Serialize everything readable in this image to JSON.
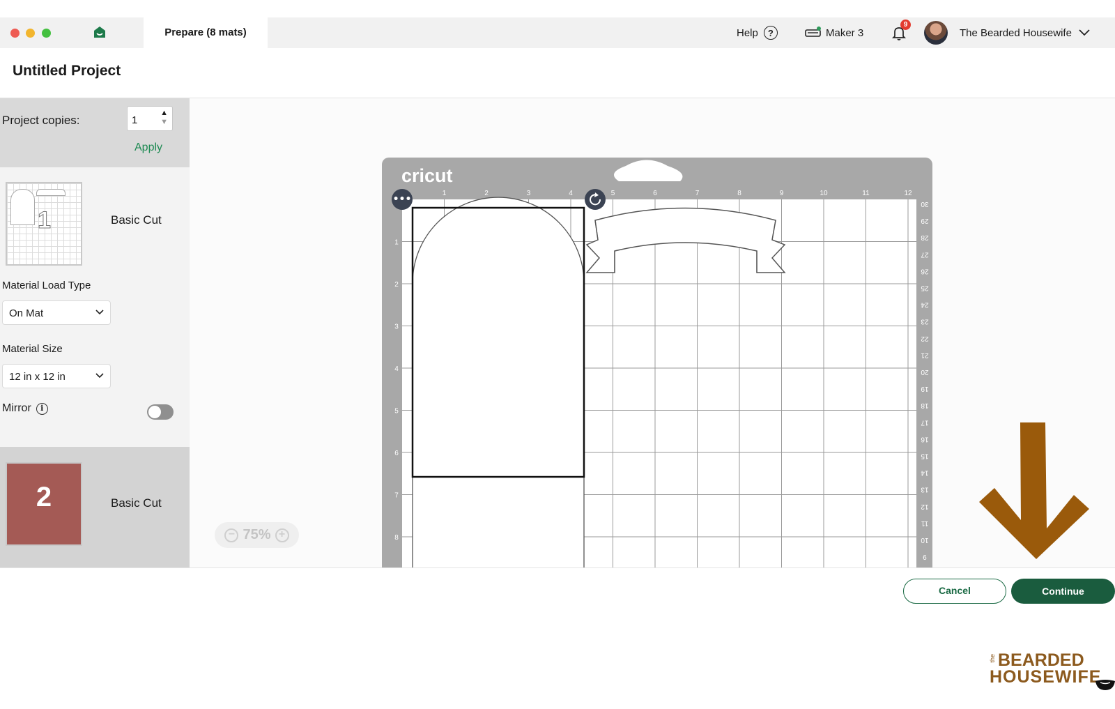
{
  "titlebar": {
    "tab_label": "Prepare (8 mats)",
    "help_label": "Help",
    "help_glyph": "?",
    "machine_label": "Maker 3",
    "notification_count": "9",
    "user_name": "The Bearded Housewife"
  },
  "project": {
    "title": "Untitled Project"
  },
  "sidebar": {
    "copies_label": "Project copies:",
    "copies_value": "1",
    "apply_label": "Apply",
    "mats": [
      {
        "number": "1",
        "cut_type": "Basic Cut",
        "color": "#ffffff"
      },
      {
        "number": "2",
        "cut_type": "Basic Cut",
        "color": "#a45a55"
      }
    ],
    "material_load_type_label": "Material Load Type",
    "material_load_type_value": "On Mat",
    "material_size_label": "Material Size",
    "material_size_value": "12 in x 12 in",
    "mirror_label": "Mirror",
    "mirror_on": false
  },
  "mat_preview": {
    "brand": "cricut",
    "top_ruler": [
      "1",
      "2",
      "3",
      "4",
      "5",
      "6",
      "7",
      "8",
      "9",
      "10",
      "11",
      "12"
    ],
    "left_ruler": [
      "1",
      "2",
      "3",
      "4",
      "5",
      "6",
      "7",
      "8"
    ],
    "right_ruler": [
      "30",
      "29",
      "28",
      "27",
      "26",
      "25",
      "24",
      "23",
      "22",
      "21",
      "20",
      "19",
      "18",
      "17",
      "16",
      "15",
      "14",
      "13",
      "12",
      "11",
      "10",
      "9"
    ]
  },
  "zoom": {
    "level": "75%",
    "minus": "−",
    "plus": "+"
  },
  "footer": {
    "cancel_label": "Cancel",
    "continue_label": "Continue"
  },
  "watermark": {
    "small": "the",
    "line1": "BEARDED",
    "line2": "HOUSEWIFE"
  },
  "colors": {
    "accent_green": "#1a5c3e",
    "apply_green": "#1d8a52",
    "arrow_brown": "#9a5a0b",
    "mat_gray": "#a8a8a8"
  }
}
